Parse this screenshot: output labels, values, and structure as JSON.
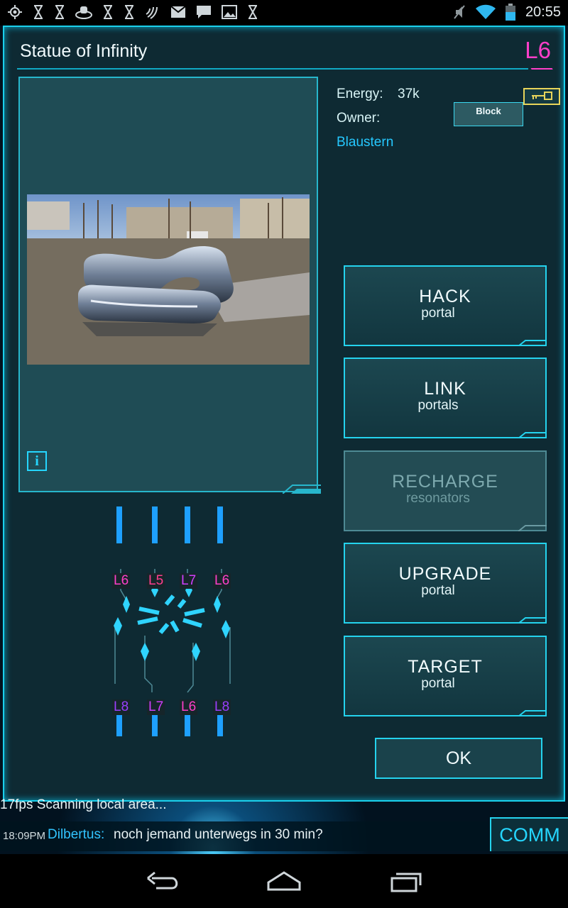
{
  "status_bar": {
    "time": "20:55",
    "left_icons": [
      "gps-icon",
      "hourglass-icon",
      "hourglass-icon",
      "ingress-icon",
      "hourglass-icon",
      "hourglass-icon",
      "nfc-icon",
      "mail-icon",
      "chat-icon",
      "image-icon",
      "hourglass-icon"
    ],
    "right_icons": [
      "mute-icon",
      "wifi-icon",
      "battery-icon"
    ]
  },
  "portal": {
    "title": "Statue of Infinity",
    "level": "L6",
    "energy_label": "Energy:",
    "energy_value": "37k",
    "owner_label": "Owner:",
    "owner_name": "Blaustern",
    "block_label": "Block",
    "info_label": "i"
  },
  "actions": [
    {
      "big": "HACK",
      "small": "portal",
      "enabled": true
    },
    {
      "big": "LINK",
      "small": "portals",
      "enabled": true
    },
    {
      "big": "RECHARGE",
      "small": "resonators",
      "enabled": false
    },
    {
      "big": "UPGRADE",
      "small": "portal",
      "enabled": true
    },
    {
      "big": "TARGET",
      "small": "portal",
      "enabled": true
    }
  ],
  "ok_label": "OK",
  "resonators": {
    "top": [
      "L6",
      "L5",
      "L7",
      "L6"
    ],
    "bottom": [
      "L8",
      "L7",
      "L6",
      "L8"
    ]
  },
  "comm": {
    "scan_text": "17fps  Scanning local area...",
    "time": "18:09PM",
    "user": "Dilbertus:",
    "message": "noch jemand unterwegs in 30 min?",
    "button_label": "COMM"
  },
  "colors": {
    "accent": "#24d3ee",
    "level_magenta": "#ff3fc9",
    "owner_blue": "#25c8ff",
    "key_yellow": "#e8d55a"
  }
}
